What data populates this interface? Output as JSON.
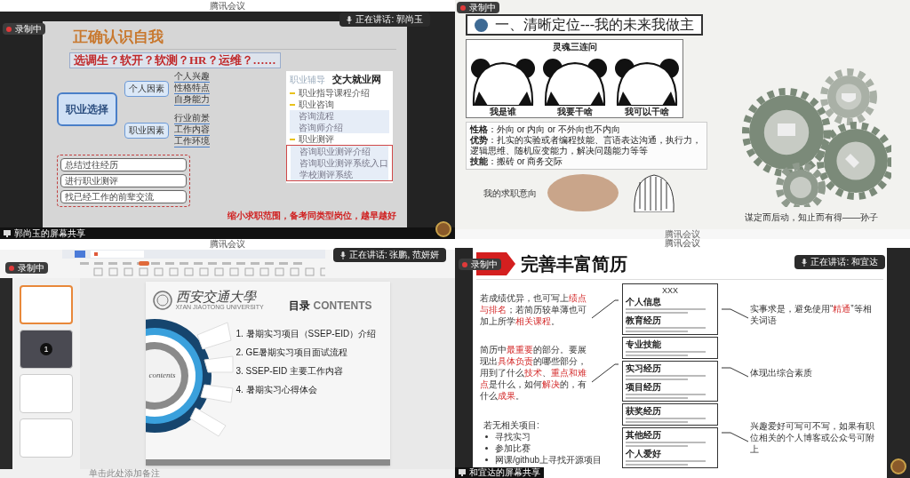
{
  "panels": [
    {
      "kind": "mindmap",
      "window_title": "腾讯会议",
      "recording": "录制中",
      "speaking": "正在讲话: 郭尚玉",
      "share_label": "郭尚玉的屏幕共享",
      "slide": {
        "title": "正确认识自我",
        "question": "选调生？软开？软测？HR？运维？……",
        "center": "职业选择",
        "branches": [
          {
            "label": "个人因素",
            "leaves": [
              "个人兴趣",
              "性格特点",
              "自身能力"
            ]
          },
          {
            "label": "职业因素",
            "leaves": [
              "行业前景",
              "工作内容",
              "工作环境"
            ]
          }
        ],
        "steps": [
          "总结过往经历",
          "进行职业测评",
          "找已经工作的前辈交流"
        ],
        "portal": {
          "tab": "职业辅导",
          "title": "交大就业网",
          "items": [
            {
              "kind": "section",
              "label": "职业指导课程介绍",
              "highlighted": false
            },
            {
              "kind": "section",
              "label": "职业咨询",
              "highlighted": false
            },
            {
              "kind": "link",
              "label": "咨询流程",
              "highlighted": false
            },
            {
              "kind": "link",
              "label": "咨询师介绍",
              "highlighted": false
            },
            {
              "kind": "section",
              "label": "职业测评",
              "highlighted": false
            },
            {
              "kind": "link",
              "label": "咨询职业测评介绍",
              "highlighted": true
            },
            {
              "kind": "link",
              "label": "咨询职业测评系统入口",
              "highlighted": true
            },
            {
              "kind": "link",
              "label": "学校测评系统",
              "highlighted": true
            }
          ]
        },
        "conclusion": "缩小求职范围，备考同类型岗位，越早越好"
      }
    },
    {
      "kind": "positioning",
      "recording": "录制中",
      "footer_title": "腾讯会议",
      "slide": {
        "heading": "一、清晰定位---我的未来我做主",
        "meme_title": "灵魂三连问",
        "captions": [
          "我是谁",
          "我要干啥",
          "我可以干啥"
        ],
        "traits": [
          "**性格**：外向 or 内向 or 不外向也不内向",
          "**优势**：扎实的实验或者编程技能、言语表达沟通，执行力，逻辑思维、随机应变能力，解决问题能力等等",
          "**技能**：搬砖 or 商务交际"
        ],
        "intent": "我的求职意向",
        "quote": "谋定而后动，知止而有得——孙子"
      }
    },
    {
      "kind": "presentation",
      "window_title": "腾讯会议",
      "recording": "录制中",
      "speaking": "正在讲话: 张鹏, 范妍妍",
      "notes_placeholder": "单击此处添加备注",
      "thumbnails": [
        {
          "selected": true
        },
        {
          "selected": false,
          "badge": "1"
        },
        {
          "selected": false
        },
        {
          "selected": false
        }
      ],
      "slide": {
        "university": "西安交通大學",
        "university_en": "XI'AN JIAOTONG UNIVERSITY",
        "heading_cn": "目录",
        "heading_en": "CONTENTS",
        "ring_label": "contents",
        "items": [
          "1.  暑期实习项目（SSEP-EID）介绍",
          "2.  GE暑期实习项目面试流程",
          "3.  SSEP-EID 主要工作内容",
          "4.  暑期实习心得体会"
        ]
      }
    },
    {
      "kind": "resume",
      "window_title": "腾讯会议",
      "recording": "录制中",
      "speaking": "正在讲话: 和宜达",
      "share_label": "和宜达的屏幕共享",
      "slide": {
        "title": "完善丰富简历",
        "left_notes": [
          [
            {
              "text": "若成绩优异，也可写上",
              "highlight": false
            },
            {
              "text": "绩点与排名",
              "highlight": true
            },
            {
              "text": "；若简历较单薄也可加上所学",
              "highlight": false
            },
            {
              "text": "相关课程",
              "highlight": true
            },
            {
              "text": "。",
              "highlight": false
            }
          ],
          [
            {
              "text": "简历中",
              "highlight": false
            },
            {
              "text": "最重要",
              "highlight": true
            },
            {
              "text": "的部分。要展现出",
              "highlight": false
            },
            {
              "text": "具体负责",
              "highlight": true
            },
            {
              "text": "的哪些部分，用到了什么",
              "highlight": false
            },
            {
              "text": "技术",
              "highlight": true
            },
            {
              "text": "、",
              "highlight": false
            },
            {
              "text": "重点和难点",
              "highlight": true
            },
            {
              "text": "是什么，如何",
              "highlight": false
            },
            {
              "text": "解决",
              "highlight": true
            },
            {
              "text": "的，有什么",
              "highlight": false
            },
            {
              "text": "成果",
              "highlight": true
            },
            {
              "text": "。",
              "highlight": false
            }
          ]
        ],
        "no_project": {
          "heading": "若无相关项目:",
          "items": [
            "寻找实习",
            "参加比赛",
            "网课/github上寻找开源项目"
          ]
        },
        "resume_boxes": [
          [
            "XXX",
            "个人信息",
            "教育经历"
          ],
          [
            "专业技能"
          ],
          [
            "实习经历",
            "项目经历"
          ],
          [
            "获奖经历"
          ],
          [
            "其他经历",
            "个人爱好"
          ]
        ],
        "right_notes": [
          [
            {
              "text": "实事求是，避免使用“",
              "highlight": false
            },
            {
              "text": "精通",
              "highlight": true
            },
            {
              "text": "”等相关词语",
              "highlight": false
            }
          ],
          [
            {
              "text": "体现出综合素质",
              "highlight": false
            }
          ],
          [
            {
              "text": "兴趣爱好可写可不写，如果有职位相关的个人博客或公众号可附上",
              "highlight": false
            }
          ]
        ]
      }
    }
  ]
}
